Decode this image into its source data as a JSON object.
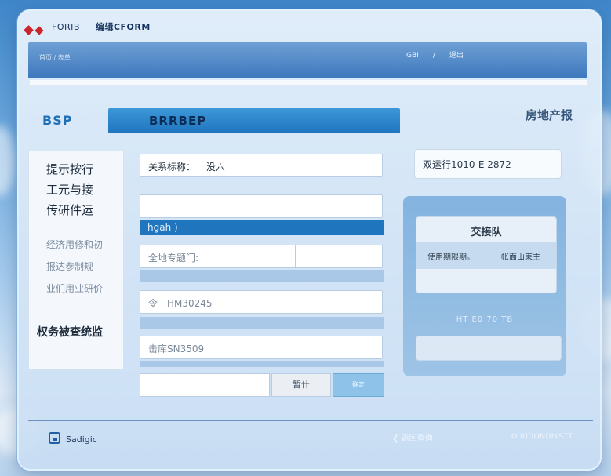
{
  "titlebar": {
    "brand": "FORIB",
    "app_name": "编辑CFORM"
  },
  "banner": {
    "breadcrumb": "首页 / 表单",
    "user_label": "GBI",
    "user_sep": "/",
    "user_action": "退出"
  },
  "header": {
    "app_title": "BSP",
    "bar_title": "BRRBEP",
    "corner_link": "房地产报"
  },
  "sidebar": {
    "main_items": [
      "提示按行",
      "工元与接",
      "传研件运"
    ],
    "sub_items": [
      "经济用修和初",
      "报达参制规",
      "业们用业研价"
    ],
    "bottom_item": "权务被查统监"
  },
  "form": {
    "field_name_label": "关系标称：",
    "field_name_value": "没六",
    "empty_field_value": "",
    "section_header": "hgah )",
    "split_field_value": "全地专题门:",
    "split_field_right": "",
    "code_field_value": "令一HM30245",
    "phone_field_value": "击库SN3509",
    "btn_blank": "",
    "btn_mid": "暂什",
    "btn_primary": "确定"
  },
  "right": {
    "info_text": "双运行1010-E 2872",
    "card_title": "交接队",
    "card_left": "使用期限期。",
    "card_right": "帐面山束主",
    "panel_label": "HT E0 70 TB",
    "panel_field": ""
  },
  "footer": {
    "left_label": "Sadigic",
    "back_label": "返回查询",
    "right_label": "O IUDONDIKSTT"
  }
}
